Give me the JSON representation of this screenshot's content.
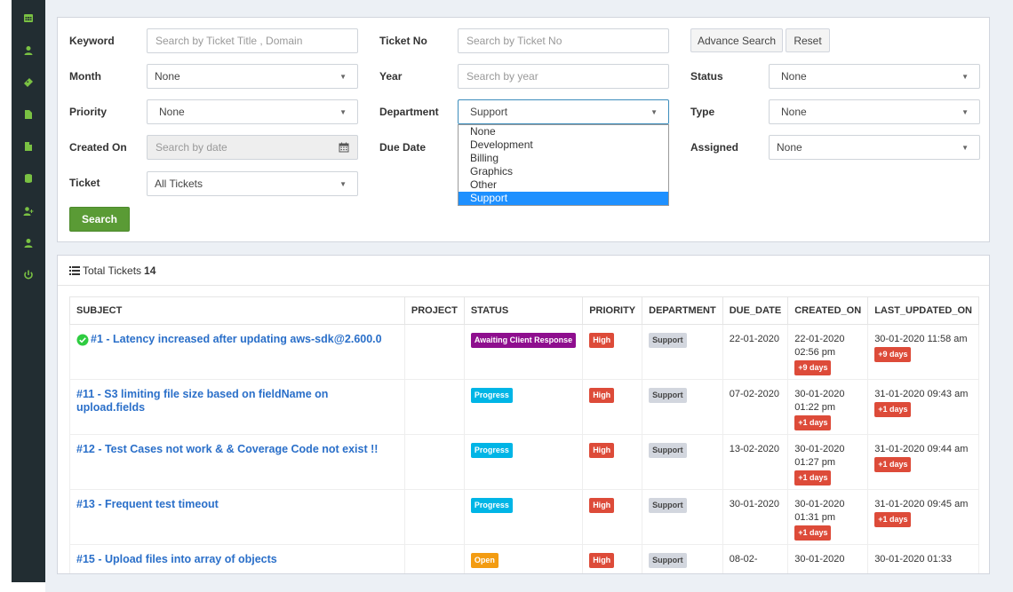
{
  "sidebar": {
    "items": [
      {
        "icon": "calendar-icon"
      },
      {
        "icon": "user-icon"
      },
      {
        "icon": "ticket-icon"
      },
      {
        "icon": "file-icon"
      },
      {
        "icon": "document-icon"
      },
      {
        "icon": "database-icon"
      },
      {
        "icon": "add-user-icon"
      },
      {
        "icon": "user-alt-icon"
      },
      {
        "icon": "power-icon"
      }
    ]
  },
  "filters": {
    "keyword": {
      "label": "Keyword",
      "placeholder": "Search by Ticket Title , Domain"
    },
    "ticket_no": {
      "label": "Ticket No",
      "placeholder": "Search by Ticket No"
    },
    "advance_search": "Advance Search",
    "reset": "Reset",
    "month": {
      "label": "Month",
      "value": "None"
    },
    "year": {
      "label": "Year",
      "placeholder": "Search by year"
    },
    "status": {
      "label": "Status",
      "value": "None"
    },
    "priority": {
      "label": "Priority",
      "value": "None"
    },
    "department": {
      "label": "Department",
      "value": "Support"
    },
    "type": {
      "label": "Type",
      "value": "None"
    },
    "created_on": {
      "label": "Created On",
      "placeholder": "Search by date"
    },
    "due_date": {
      "label": "Due Date"
    },
    "assigned": {
      "label": "Assigned",
      "value": "None"
    },
    "ticket": {
      "label": "Ticket",
      "value": "All Tickets"
    },
    "search_button": "Search"
  },
  "department_dropdown": {
    "options": [
      "None",
      "Development",
      "Billing",
      "Graphics",
      "Other",
      "Support"
    ],
    "selected": "Support"
  },
  "list": {
    "total_label": "Total Tickets",
    "total_count": "14",
    "columns": [
      "SUBJECT",
      "PROJECT",
      "STATUS",
      "PRIORITY",
      "DEPARTMENT",
      "DUE_DATE",
      "CREATED_ON",
      "LAST_UPDATED_ON"
    ],
    "rows": [
      {
        "subject": "#1 - Latency increased after updating aws-sdk@2.600.0",
        "project": "",
        "status": "Awaiting Client Response",
        "priority": "High",
        "department": "Support",
        "due": "22-01-2020",
        "created": "22-01-2020 02:56 pm",
        "created_days": "+9 days",
        "updated": "30-01-2020 11:58 am",
        "updated_days": "+9 days",
        "resolved_icon": true
      },
      {
        "subject": "#11 - S3 limiting file size based on fieldName on upload.fields",
        "project": "",
        "status": "Progress",
        "priority": "High",
        "department": "Support",
        "due": "07-02-2020",
        "created": "30-01-2020 01:22 pm",
        "created_days": "+1 days",
        "updated": "31-01-2020 09:43 am",
        "updated_days": "+1 days",
        "resolved_icon": false
      },
      {
        "subject": "#12 - Test Cases not work & & Coverage Code not exist !!",
        "project": "",
        "status": "Progress",
        "priority": "High",
        "department": "Support",
        "due": "13-02-2020",
        "created": "30-01-2020 01:27 pm",
        "created_days": "+1 days",
        "updated": "31-01-2020 09:44 am",
        "updated_days": "+1 days",
        "resolved_icon": false
      },
      {
        "subject": "#13 - Frequent test timeout",
        "project": "",
        "status": "Progress",
        "priority": "High",
        "department": "Support",
        "due": "30-01-2020",
        "created": "30-01-2020 01:31 pm",
        "created_days": "+1 days",
        "updated": "31-01-2020 09:45 am",
        "updated_days": "+1 days",
        "resolved_icon": false
      },
      {
        "subject": "#15 - Upload files into array of objects",
        "project": "",
        "status": "Open",
        "priority": "High",
        "department": "Support",
        "due": "08-02-",
        "created": "30-01-2020",
        "created_days": "",
        "updated": "30-01-2020 01:33",
        "updated_days": "",
        "resolved_icon": false
      }
    ]
  },
  "colors": {
    "sidebar_bg": "#222d32",
    "sidebar_icon": "#7ac143",
    "link": "#2a6fc9",
    "search_btn": "#5a9b35",
    "awaiting": "#8e0e8e",
    "progress": "#00b5e6",
    "open": "#f39c12",
    "high": "#dd4b39",
    "dropdown_highlight": "#1e90ff"
  }
}
